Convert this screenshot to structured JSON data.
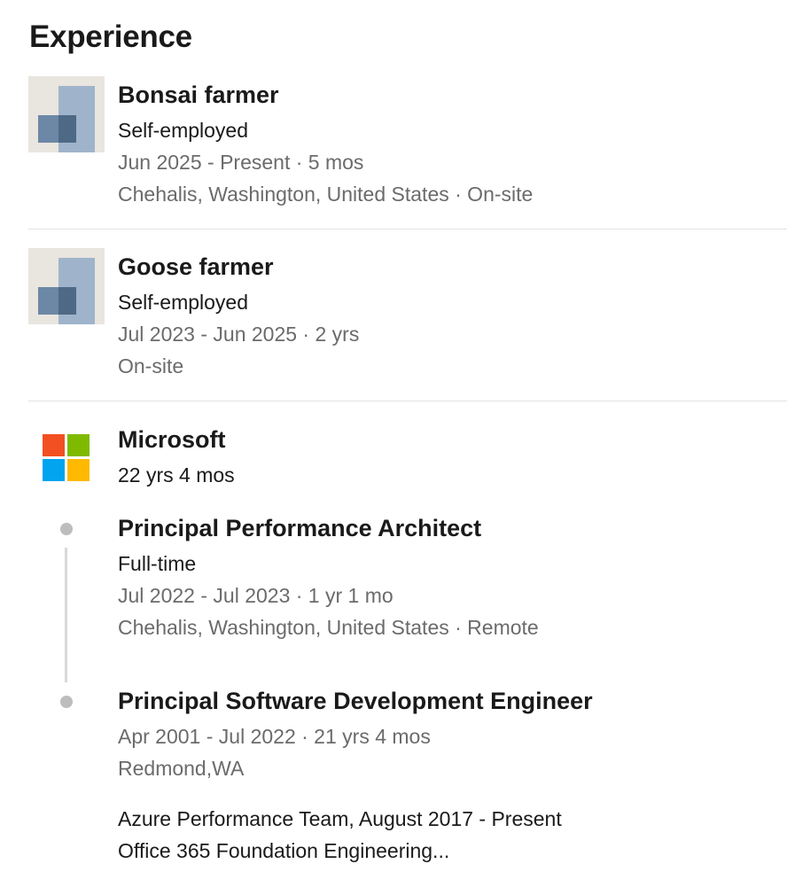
{
  "section": {
    "title": "Experience"
  },
  "entries": [
    {
      "title": "Bonsai farmer",
      "company": "Self-employed",
      "dates": "Jun 2025 - Present · 5 mos",
      "location": "Chehalis, Washington, United States · On-site"
    },
    {
      "title": "Goose farmer",
      "company": "Self-employed",
      "dates": "Jul 2023 - Jun 2025 · 2 yrs",
      "location": "On-site"
    }
  ],
  "microsoft": {
    "company": "Microsoft",
    "total_duration": "22 yrs 4 mos",
    "logo_colors": [
      "#f25022",
      "#7fba00",
      "#00a4ef",
      "#ffb900"
    ],
    "roles": [
      {
        "title": "Principal Performance Architect",
        "employment_type": "Full-time",
        "dates": "Jul 2022 - Jul 2023 · 1 yr 1 mo",
        "location": "Chehalis, Washington, United States · Remote"
      },
      {
        "title": "Principal Software Development Engineer",
        "dates": "Apr 2001 - Jul 2022 · 21 yrs 4 mos",
        "location": "Redmond,WA",
        "description_line1": "Azure Performance Team, August 2017 - Present",
        "description_line2": "Office 365 Foundation Engineering..."
      }
    ]
  },
  "colors": {
    "text_primary": "#1a1a1a",
    "text_secondary": "#6b6b6b",
    "divider": "#e3e3e3",
    "timeline": "#bdbdbd"
  }
}
